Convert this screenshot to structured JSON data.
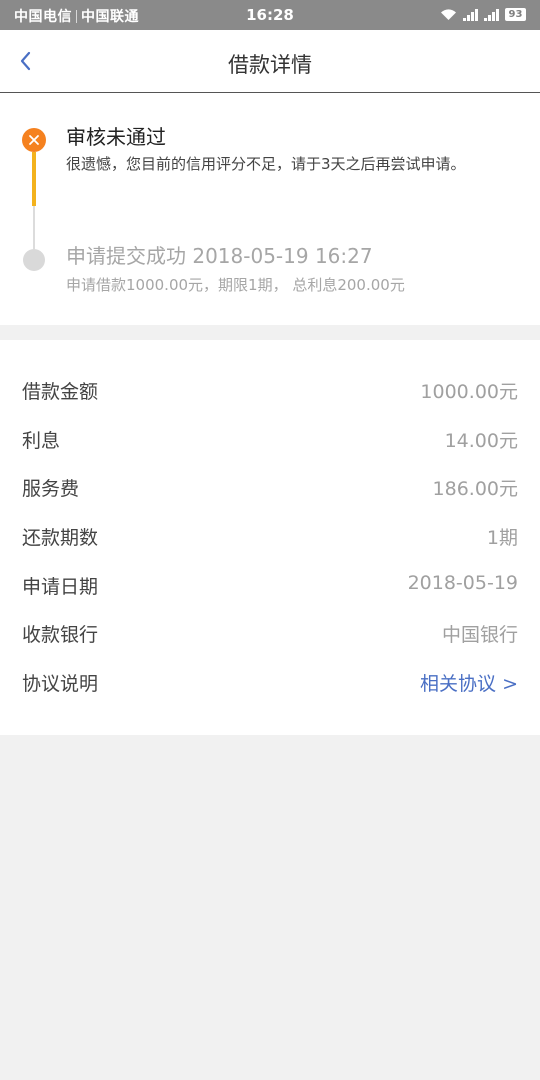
{
  "status_bar": {
    "carrier1": "中国电信",
    "carrier2": "中国联通",
    "time": "16:28",
    "battery": "93"
  },
  "nav": {
    "title": "借款详情",
    "back_icon": "chevron-left-icon"
  },
  "timeline": [
    {
      "title": "审核未通过",
      "desc": "很遗憾，您目前的信用评分不足，请于3天之后再尝试申请。",
      "state": "rejected",
      "icon": "close-icon",
      "color": "#f5811f"
    },
    {
      "title": "申请提交成功 2018-05-19 16:27",
      "desc": "申请借款1000.00元，期限1期， 总利息200.00元",
      "state": "done",
      "color": "#d9d9d9"
    }
  ],
  "details": [
    {
      "label": "借款金额",
      "value": "1000.00元"
    },
    {
      "label": "利息",
      "value": "14.00元"
    },
    {
      "label": "服务费",
      "value": "186.00元"
    },
    {
      "label": "还款期数",
      "value": "1期"
    },
    {
      "label": "申请日期",
      "value": "2018-05-19"
    },
    {
      "label": "收款银行",
      "value": "中国银行"
    },
    {
      "label": "协议说明",
      "value": "相关协议 >"
    }
  ],
  "colors": {
    "accent": "#4a6fc4",
    "warning": "#f5811f",
    "progress": "#f3b21d"
  }
}
